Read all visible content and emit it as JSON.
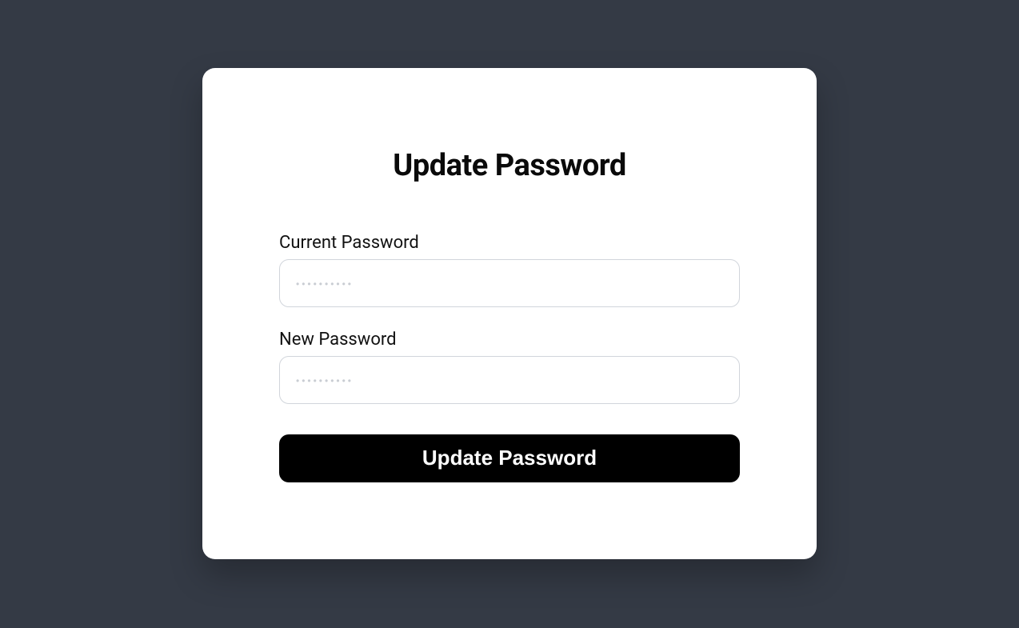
{
  "card": {
    "title": "Update Password"
  },
  "form": {
    "current_password": {
      "label": "Current Password",
      "placeholder": "••••••••••",
      "value": ""
    },
    "new_password": {
      "label": "New Password",
      "placeholder": "••••••••••",
      "value": ""
    },
    "submit_label": "Update Password"
  }
}
